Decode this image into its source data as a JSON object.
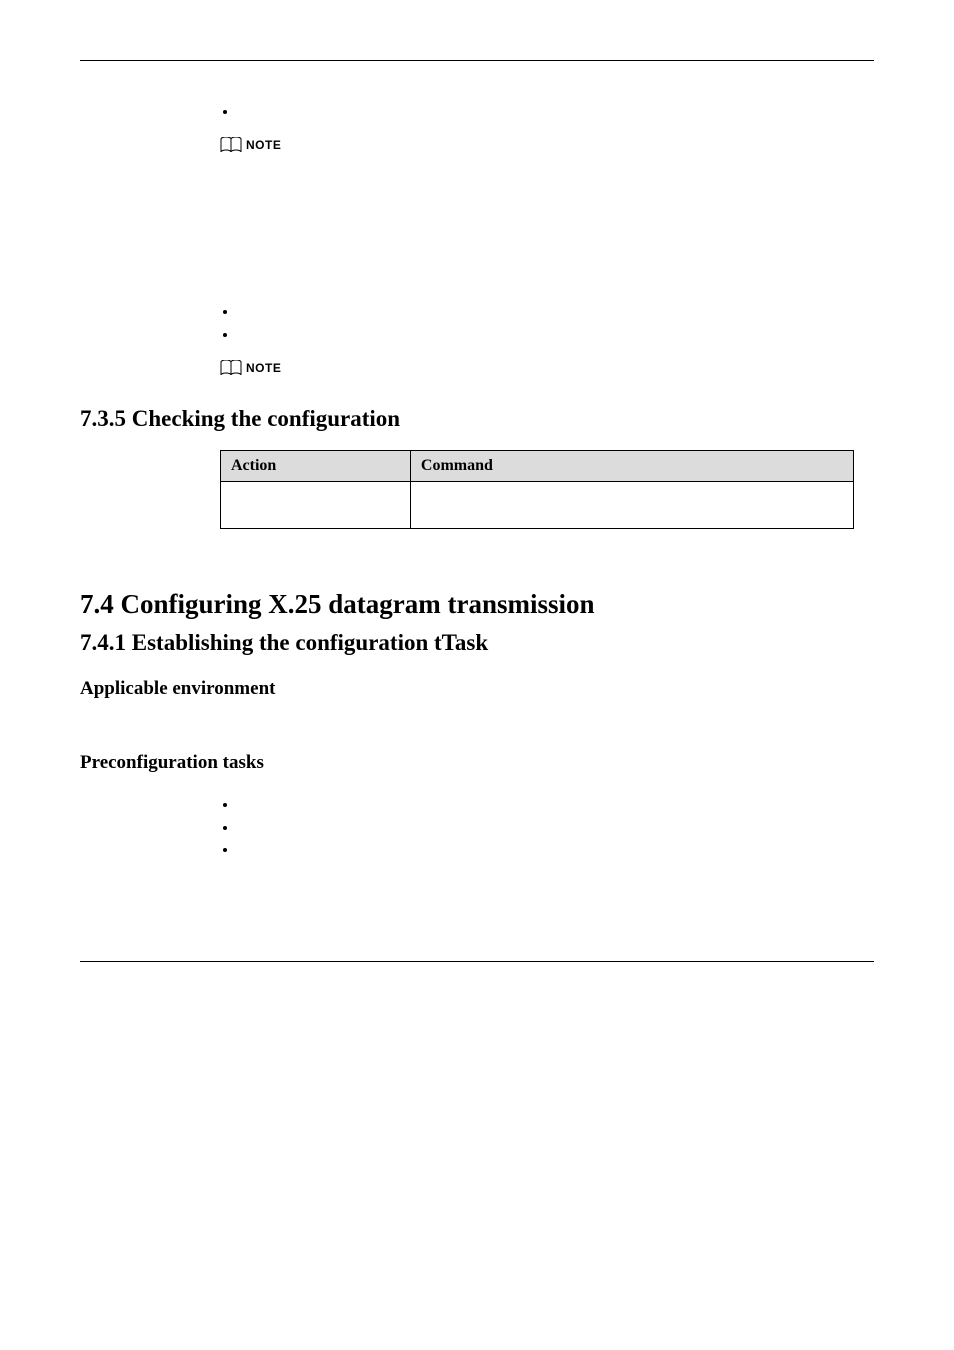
{
  "note_label": "NOTE",
  "section_7_3_5": {
    "number": "7.3.5",
    "title": "Checking the configuration",
    "table": {
      "headers": [
        "Action",
        "Command"
      ],
      "rows": [
        [
          "",
          ""
        ]
      ]
    }
  },
  "section_7_4": {
    "number": "7.4",
    "title": "Configuring X.25 datagram transmission"
  },
  "section_7_4_1": {
    "number": "7.4.1",
    "title": "Establishing the configuration tTask",
    "sub_a": "Applicable environment",
    "sub_b": "Preconfiguration tasks"
  },
  "bullets_top": [
    ""
  ],
  "bullets_mid": [
    "",
    ""
  ],
  "bullets_bottom": [
    "",
    "",
    ""
  ]
}
